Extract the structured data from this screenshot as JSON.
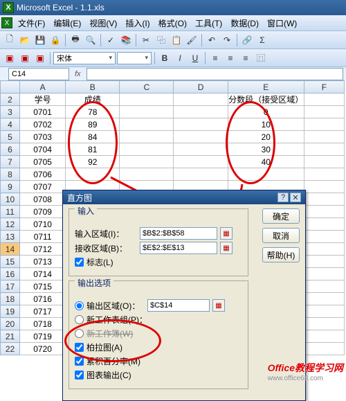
{
  "titlebar": {
    "title": "Microsoft Excel - 1.1.xls"
  },
  "menubar": {
    "items": [
      "文件(F)",
      "编辑(E)",
      "视图(V)",
      "插入(I)",
      "格式(O)",
      "工具(T)",
      "数据(D)",
      "窗口(W)"
    ]
  },
  "toolbar2": {
    "font": "宋体",
    "btn_bold": "B",
    "btn_italic": "I",
    "btn_underline": "U"
  },
  "namebox": {
    "ref": "C14",
    "fx": "fx"
  },
  "columns": [
    "A",
    "B",
    "C",
    "D",
    "E",
    "F"
  ],
  "headers": {
    "A": "学号",
    "B": "成绩",
    "E": "分数段（接受区域）"
  },
  "rows": [
    {
      "n": 2,
      "A": "学号",
      "B": "成绩",
      "E": "分数段（接受区域）"
    },
    {
      "n": 3,
      "A": "0701",
      "B": "78",
      "E": "0"
    },
    {
      "n": 4,
      "A": "0702",
      "B": "89",
      "E": "10"
    },
    {
      "n": 5,
      "A": "0703",
      "B": "84",
      "E": "20"
    },
    {
      "n": 6,
      "A": "0704",
      "B": "81",
      "E": "30"
    },
    {
      "n": 7,
      "A": "0705",
      "B": "92",
      "E": "40"
    },
    {
      "n": 8,
      "A": "0706",
      "B": ""
    },
    {
      "n": 9,
      "A": "0707",
      "B": ""
    },
    {
      "n": 10,
      "A": "0708"
    },
    {
      "n": 11,
      "A": "0709"
    },
    {
      "n": 12,
      "A": "0710"
    },
    {
      "n": 13,
      "A": "0711"
    },
    {
      "n": 14,
      "A": "0712"
    },
    {
      "n": 15,
      "A": "0713"
    },
    {
      "n": 16,
      "A": "0714"
    },
    {
      "n": 17,
      "A": "0715"
    },
    {
      "n": 18,
      "A": "0716"
    },
    {
      "n": 19,
      "A": "0717"
    },
    {
      "n": 20,
      "A": "0718"
    },
    {
      "n": 21,
      "A": "0719"
    },
    {
      "n": 22,
      "A": "0720"
    }
  ],
  "dialog": {
    "title": "直方图",
    "group_input": "输入",
    "lbl_input_range": "输入区域(I)：",
    "val_input_range": "$B$2:$B$58",
    "lbl_bin_range": "接收区域(B)：",
    "val_bin_range": "$E$2:$E$13",
    "chk_labels": "标志(L)",
    "group_output": "输出选项",
    "radio_output_range": "输出区域(O)：",
    "val_output_range": "$C$14",
    "radio_new_ws": "新工作表组(P)：",
    "radio_new_wb": "新工作簿(W)",
    "chk_pareto": "柏拉图(A)",
    "chk_cumpct": "累积百分率(M)",
    "chk_chart": "图表输出(C)",
    "btn_ok": "确定",
    "btn_cancel": "取消",
    "btn_help": "帮助(H)"
  },
  "watermark": {
    "main": "Office教程学习网",
    "sub": "www.office68.com"
  }
}
